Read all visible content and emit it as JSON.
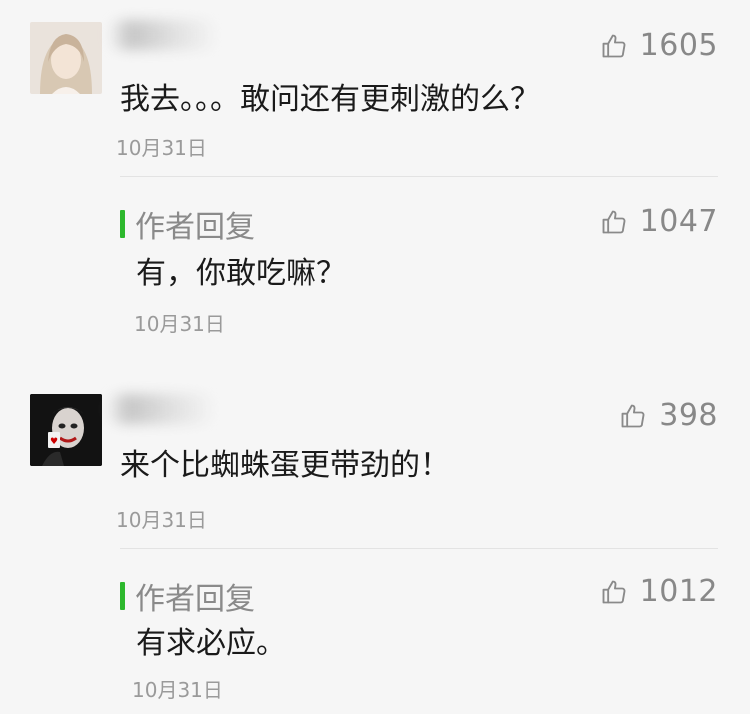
{
  "comments": [
    {
      "likes": "1605",
      "text": "我去。。。敢问还有更刺激的么？",
      "date": "10月31日",
      "reply": {
        "tag": "作者回复",
        "likes": "1047",
        "text": "有，你敢吃嘛？",
        "date": "10月31日"
      }
    },
    {
      "likes": "398",
      "text": "来个比蜘蛛蛋更带劲的！",
      "date": "10月31日",
      "reply": {
        "tag": "作者回复",
        "likes": "1012",
        "text": "有求必应。",
        "date": "10月31日"
      }
    }
  ],
  "colors": {
    "background": "#f6f6f6",
    "author_bar": "#2db82d",
    "muted_text": "#888888"
  },
  "icons": [
    "thumbs-up-icon",
    "avatar-girl",
    "avatar-joker"
  ]
}
